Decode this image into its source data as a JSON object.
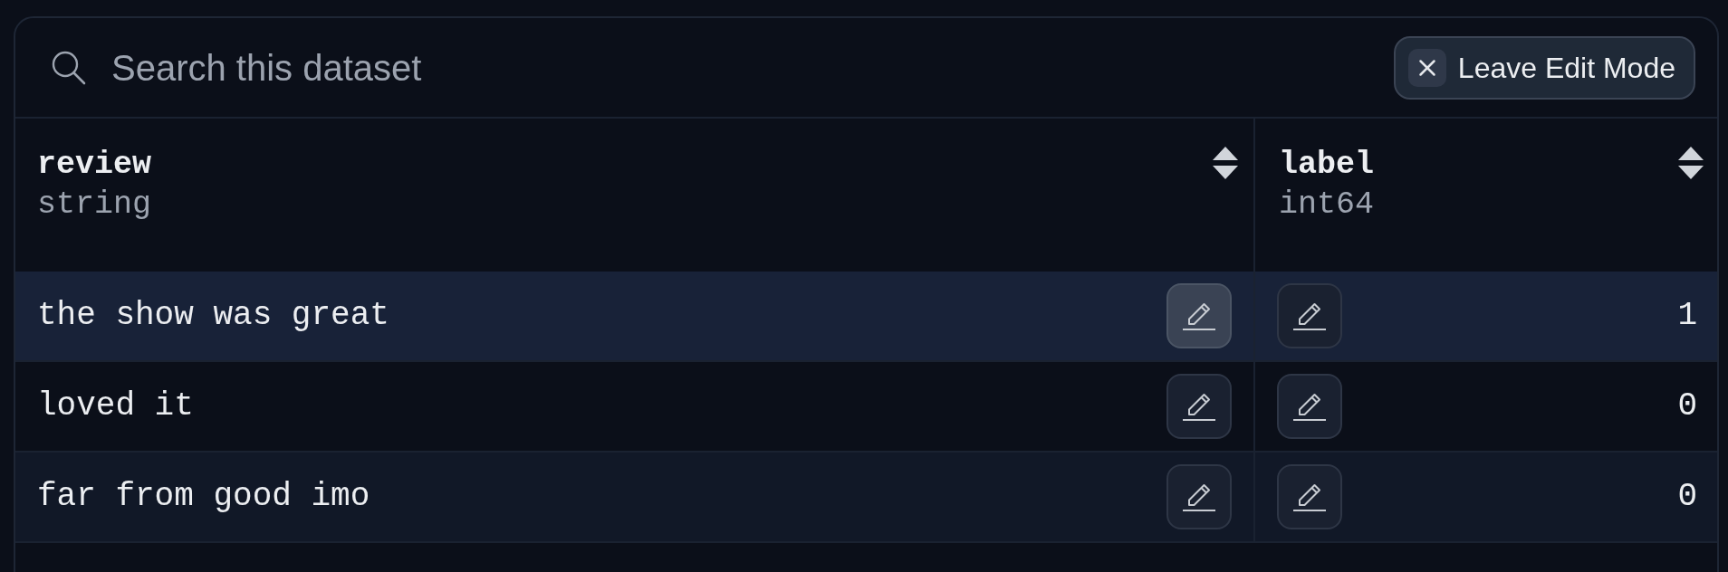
{
  "search": {
    "placeholder": "Search this dataset"
  },
  "edit_mode_button": {
    "label": "Leave Edit Mode"
  },
  "table": {
    "columns": [
      {
        "name": "review",
        "type": "string",
        "kind": "text"
      },
      {
        "name": "label",
        "type": "int64",
        "kind": "number"
      }
    ],
    "rows": [
      {
        "selected": true,
        "cells": [
          {
            "value": "the show was great",
            "edit_active": true
          },
          {
            "value": "1",
            "edit_active": false
          }
        ]
      },
      {
        "selected": false,
        "cells": [
          {
            "value": "loved it",
            "edit_active": false
          },
          {
            "value": "0",
            "edit_active": false
          }
        ]
      },
      {
        "selected": false,
        "cells": [
          {
            "value": "far from good imo",
            "edit_active": false
          },
          {
            "value": "0",
            "edit_active": false
          }
        ]
      }
    ]
  }
}
